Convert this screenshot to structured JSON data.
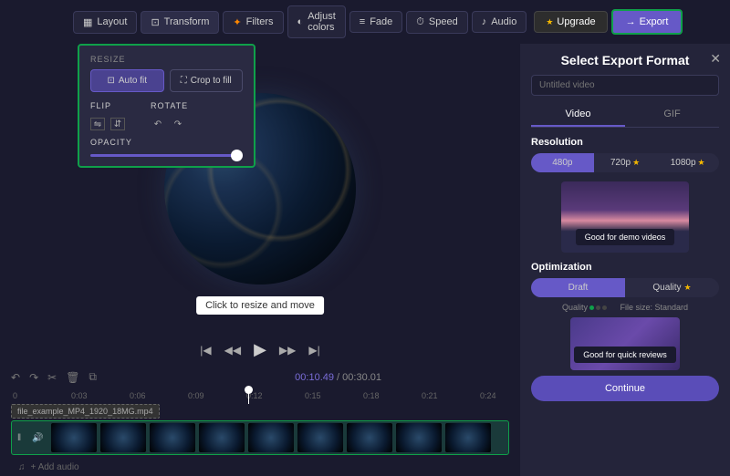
{
  "toolbar": {
    "layout": "Layout",
    "transform": "Transform",
    "filters": "Filters",
    "adjust": "Adjust colors",
    "fade": "Fade",
    "speed": "Speed",
    "audio": "Audio",
    "upgrade": "Upgrade",
    "export": "Export"
  },
  "transform_panel": {
    "resize": "RESIZE",
    "autofit": "Auto fit",
    "crop": "Crop to fill",
    "flip": "FLIP",
    "rotate": "ROTATE",
    "opacity": "OPACITY"
  },
  "preview": {
    "overlay": "Click to resize and move"
  },
  "time": {
    "current": "00:10",
    "frames": ".49",
    "total": "00:30",
    "tframes": ".01"
  },
  "ruler": [
    "0",
    "0:03",
    "0:06",
    "0:09",
    "0:12",
    "0:15",
    "0:18",
    "0:21",
    "0:24"
  ],
  "clip": {
    "name": "file_example_MP4_1920_18MG.mp4",
    "audio": "+ Add audio"
  },
  "export": {
    "title": "Select Export Format",
    "placeholder": "Untitled video",
    "tabs": {
      "video": "Video",
      "gif": "GIF"
    },
    "resolution": "Resolution",
    "res": {
      "a": "480p",
      "b": "720p",
      "c": "1080p"
    },
    "caption1": "Good for demo videos",
    "optimization": "Optimization",
    "opt": {
      "draft": "Draft",
      "quality": "Quality"
    },
    "quality_label": "Quality",
    "filesize_label": "File size:",
    "filesize": "Standard",
    "caption2": "Good for quick reviews",
    "continue": "Continue"
  }
}
